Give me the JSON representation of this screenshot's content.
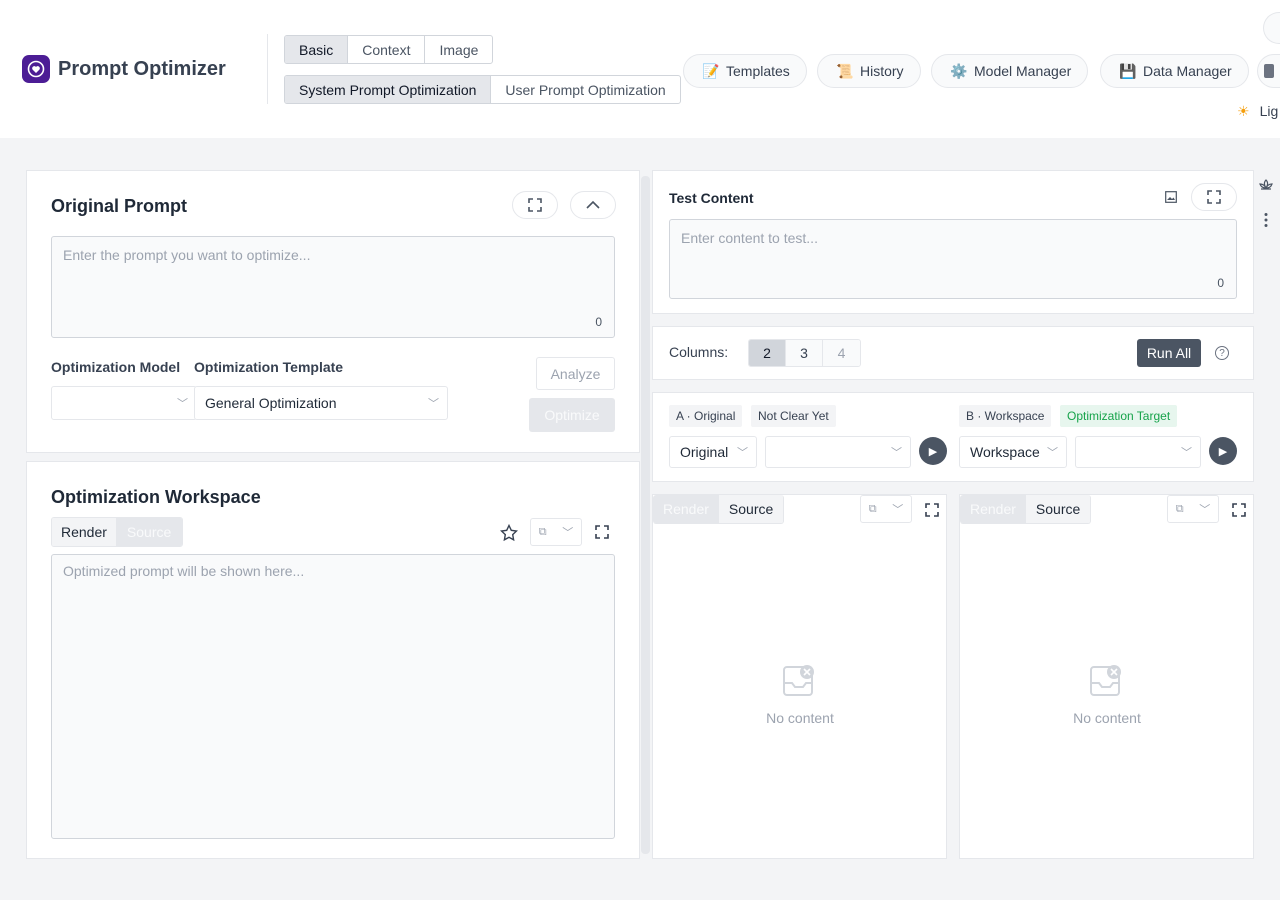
{
  "app": {
    "title": "Prompt Optimizer"
  },
  "mode_tabs": [
    "Basic",
    "Context",
    "Image"
  ],
  "prompt_tabs": [
    "System Prompt Optimization",
    "User Prompt Optimization"
  ],
  "nav": {
    "templates": "Templates",
    "history": "History",
    "model_manager": "Model Manager",
    "data_manager": "Data Manager",
    "theme": "Lig"
  },
  "original_prompt": {
    "title": "Original Prompt",
    "placeholder": "Enter the prompt you want to optimize...",
    "count": "0",
    "model_label": "Optimization Model",
    "model_value": "",
    "template_label": "Optimization Template",
    "template_value": "General Optimization",
    "analyze": "Analyze",
    "optimize": "Optimize"
  },
  "workspace": {
    "title": "Optimization Workspace",
    "tab_render": "Render",
    "tab_source": "Source",
    "placeholder": "Optimized prompt will be shown here..."
  },
  "test": {
    "title": "Test Content",
    "placeholder": "Enter content to test...",
    "count": "0"
  },
  "columns": {
    "label": "Columns:",
    "options": [
      "2",
      "3",
      "4"
    ],
    "selected": "2",
    "run_all": "Run All",
    "help": "?"
  },
  "variants": {
    "a_label": "A · Original",
    "a_status": "Not Clear Yet",
    "a_select": "Original",
    "b_label": "B · Workspace",
    "b_status": "Optimization Target",
    "b_select": "Workspace"
  },
  "results": {
    "tab_render": "Render",
    "tab_source": "Source",
    "empty": "No content"
  },
  "colors": {
    "brand": "#4c1d95",
    "success": "#16a34a",
    "dark_button": "#4b5563"
  }
}
